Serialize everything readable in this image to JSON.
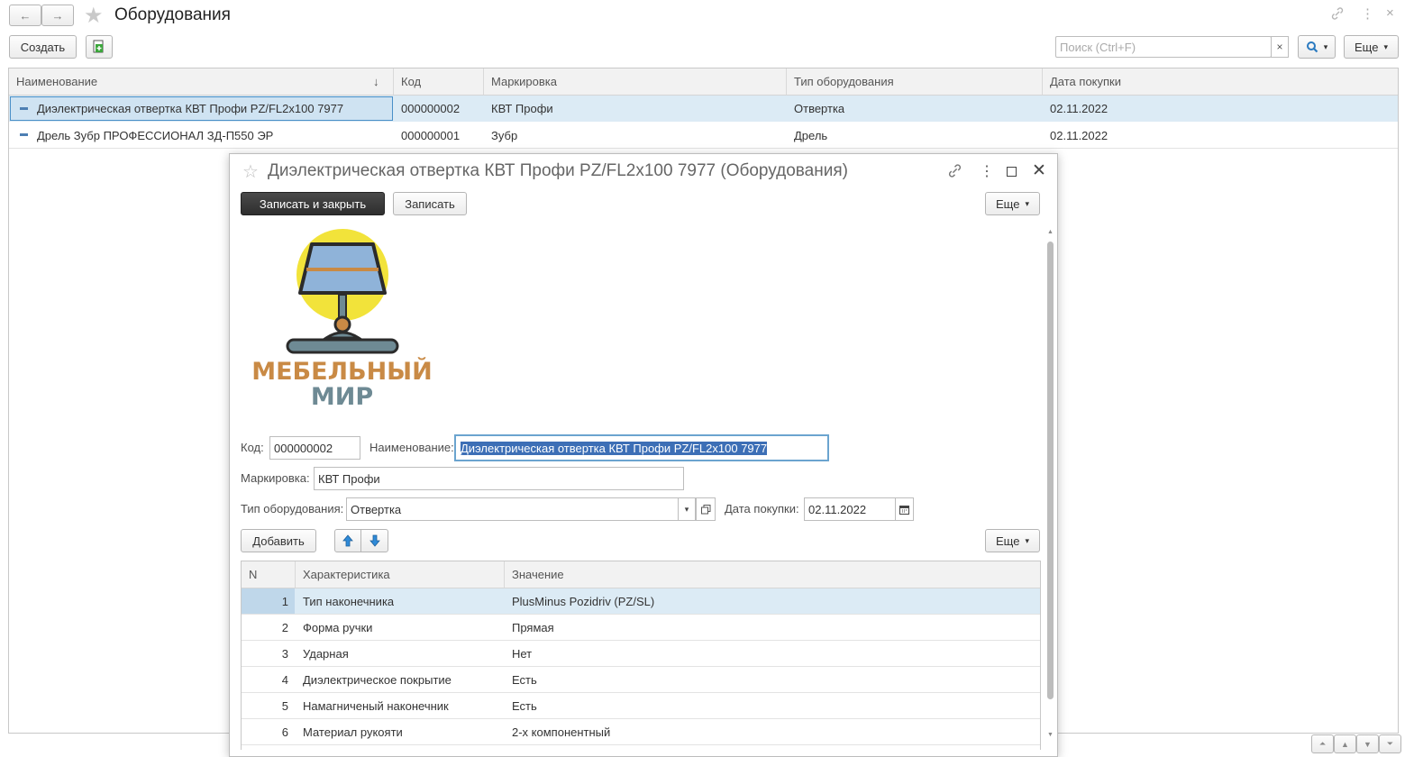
{
  "header": {
    "title": "Оборудования"
  },
  "toolbar": {
    "create_label": "Создать",
    "search_placeholder": "Поиск (Ctrl+F)",
    "clear_symbol": "×",
    "more_label": "Еще"
  },
  "list": {
    "columns": [
      "Наименование",
      "Код",
      "Маркировка",
      "Тип оборудования",
      "Дата покупки"
    ],
    "sort_indicator": "↓",
    "rows": [
      {
        "name": "Диэлектрическая отвертка КВТ Профи PZ/FL2x100 7977",
        "code": "000000002",
        "marking": "КВТ Профи",
        "type": "Отвертка",
        "date": "02.11.2022"
      },
      {
        "name": "Дрель Зубр ПРОФЕССИОНАЛ ЗД-П550 ЭР",
        "code": "000000001",
        "marking": "Зубр",
        "type": "Дрель",
        "date": "02.11.2022"
      }
    ]
  },
  "dialog": {
    "title": "Диэлектрическая отвертка КВТ Профи PZ/FL2x100 7977 (Оборудования)",
    "save_close_label": "Записать и закрыть",
    "save_label": "Записать",
    "more_label": "Еще",
    "logo": {
      "line1": "МЕБЕЛЬНЫЙ",
      "line2": "МИР"
    },
    "form": {
      "code_label": "Код:",
      "code_value": "000000002",
      "name_label": "Наименование:",
      "name_value": "Диэлектрическая отвертка КВТ Профи PZ/FL2x100 7977",
      "marking_label": "Маркировка:",
      "marking_value": "КВТ Профи",
      "type_label": "Тип оборудования:",
      "type_value": "Отвертка",
      "date_label": "Дата покупки:",
      "date_value": "02.11.2022"
    },
    "table_toolbar": {
      "add_label": "Добавить",
      "more_label": "Еще"
    },
    "characteristics": {
      "columns": [
        "N",
        "Характеристика",
        "Значение"
      ],
      "rows": [
        {
          "n": "1",
          "name": "Тип наконечника",
          "value": "PlusMinus Pozidriv (PZ/SL)"
        },
        {
          "n": "2",
          "name": "Форма ручки",
          "value": "Прямая"
        },
        {
          "n": "3",
          "name": "Ударная",
          "value": "Нет"
        },
        {
          "n": "4",
          "name": "Диэлектрическое покрытие",
          "value": "Есть"
        },
        {
          "n": "5",
          "name": "Намагниченый наконечник",
          "value": "Есть"
        },
        {
          "n": "6",
          "name": "Материал рукояти",
          "value": "2-х компонентный"
        }
      ]
    }
  },
  "colors": {
    "selected_row": "#dcebf5",
    "accent": "#4a90c8",
    "logo_yellow": "#f2e33a",
    "logo_brown": "#c98a45",
    "logo_slate": "#6e8a94"
  }
}
